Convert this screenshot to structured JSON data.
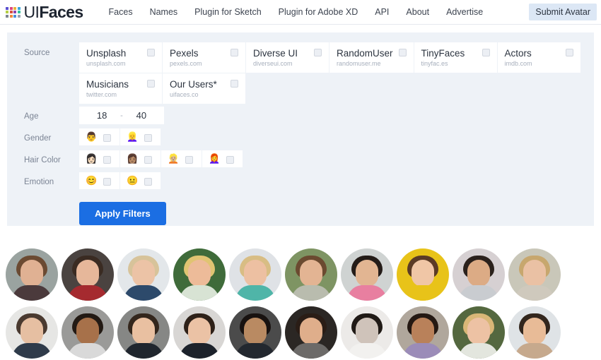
{
  "header": {
    "brand_thin": "UI",
    "brand_bold": "Faces",
    "logo_name": "uifaces-logo-grid",
    "logo_colors": [
      "#5a4fcf",
      "#e0457b",
      "#e8b23a",
      "#3aa7dc",
      "#b5cf44",
      "#d94f3d",
      "#8e44ad",
      "#36c2a0",
      "#7d8591",
      "#f08a3c",
      "#4a90d9",
      "#9aa3b0"
    ],
    "nav": [
      {
        "label": "Faces"
      },
      {
        "label": "Names"
      },
      {
        "label": "Plugin for Sketch"
      },
      {
        "label": "Plugin for Adobe XD"
      },
      {
        "label": "API"
      },
      {
        "label": "About"
      },
      {
        "label": "Advertise"
      }
    ],
    "cta_label": "Submit Avatar",
    "cta_bg": "#dce7f5"
  },
  "filters": {
    "source_label": "Source",
    "age_label": "Age",
    "gender_label": "Gender",
    "hair_label": "Hair Color",
    "emotion_label": "Emotion",
    "sources": [
      {
        "name": "Unsplash",
        "domain": "unsplash.com",
        "checked": false
      },
      {
        "name": "Pexels",
        "domain": "pexels.com",
        "checked": false
      },
      {
        "name": "Diverse UI",
        "domain": "diverseui.com",
        "checked": false
      },
      {
        "name": "RandomUser",
        "domain": "randomuser.me",
        "checked": false
      },
      {
        "name": "TinyFaces",
        "domain": "tinyfac.es",
        "checked": false
      },
      {
        "name": "Actors",
        "domain": "imdb.com",
        "checked": false
      },
      {
        "name": "Musicians",
        "domain": "twitter.com",
        "checked": false
      },
      {
        "name": "Our Users*",
        "domain": "uifaces.co",
        "checked": false
      }
    ],
    "age": {
      "min": "18",
      "max": "40",
      "separator": "-"
    },
    "genders": [
      {
        "icon": "man-emoji",
        "glyph": "👨",
        "checked": false
      },
      {
        "icon": "woman-emoji",
        "glyph": "👱‍♀️",
        "checked": false
      }
    ],
    "hair_colors": [
      {
        "icon": "black-hair-emoji",
        "glyph": "👩🏻",
        "checked": false
      },
      {
        "icon": "brown-hair-emoji",
        "glyph": "👩🏽",
        "checked": false
      },
      {
        "icon": "blonde-hair-emoji",
        "glyph": "👱🏼",
        "checked": false
      },
      {
        "icon": "red-hair-emoji",
        "glyph": "👩‍🦰",
        "checked": false
      }
    ],
    "emotions": [
      {
        "icon": "smiling-face-emoji",
        "glyph": "😊",
        "checked": false
      },
      {
        "icon": "neutral-face-emoji",
        "glyph": "😐",
        "checked": false
      }
    ],
    "apply_label": "Apply Filters",
    "apply_color": "#1b6ee3",
    "panel_bg": "#eef2f7"
  },
  "avatars": [
    {
      "alt": "bearded man outdoors",
      "bg": "#9aa3a0",
      "hair": "#6b4a32",
      "skin": "#e0b193",
      "body": "#4b3a3c"
    },
    {
      "alt": "smiling woman red sweater",
      "bg": "#4a4340",
      "hair": "#3a2b22",
      "skin": "#e6b79a",
      "body": "#a52a2f"
    },
    {
      "alt": "short blonde hair woman",
      "bg": "#e3e7ea",
      "hair": "#d7c39a",
      "skin": "#ecc3a6",
      "body": "#2d4a6b"
    },
    {
      "alt": "blonde woman green backdrop",
      "bg": "#3f6b3a",
      "hair": "#e0c472",
      "skin": "#edbb99",
      "body": "#d8e3d4"
    },
    {
      "alt": "blonde woman teal necklace",
      "bg": "#dfe2e6",
      "hair": "#d8bd84",
      "skin": "#edc0a2",
      "body": "#4fb5a8"
    },
    {
      "alt": "young man green backdrop",
      "bg": "#7e9463",
      "hair": "#6b4a30",
      "skin": "#e3b493",
      "body": "#b9bcae"
    },
    {
      "alt": "man with glasses pink shirt",
      "bg": "#cfd3d2",
      "hair": "#241c18",
      "skin": "#e2b592",
      "body": "#e87fa0"
    },
    {
      "alt": "woman yellow backdrop",
      "bg": "#e8c319",
      "hair": "#5b3b26",
      "skin": "#f0c6a6",
      "body": "#e8c319"
    },
    {
      "alt": "man grey backdrop",
      "bg": "#d6d0d2",
      "hair": "#2b211c",
      "skin": "#dcab85",
      "body": "#c9ccd0"
    },
    {
      "alt": "long haired blonde woman",
      "bg": "#c9c7b9",
      "hair": "#c7a76e",
      "skin": "#eac1a4",
      "body": "#cfc9bd"
    },
    {
      "alt": "young man light backdrop",
      "bg": "#e6e6e4",
      "hair": "#4a3a30",
      "skin": "#e6bfa2",
      "body": "#2f3b4a"
    },
    {
      "alt": "smiling man grey backdrop",
      "bg": "#9a9a98",
      "hair": "#231a14",
      "skin": "#a7714a",
      "body": "#d9d9d9"
    },
    {
      "alt": "smiling man dark jacket",
      "bg": "#868785",
      "hair": "#33261c",
      "skin": "#e9c0a1",
      "body": "#20262e"
    },
    {
      "alt": "woman dark blazer",
      "bg": "#d8d6d4",
      "hair": "#2e2119",
      "skin": "#ebc2a5",
      "body": "#1c222b"
    },
    {
      "alt": "man in suit and tie",
      "bg": "#4b4b4b",
      "hair": "#181210",
      "skin": "#b98a62",
      "body": "#23282f"
    },
    {
      "alt": "man in suit dark backdrop",
      "bg": "#2b2724",
      "hair": "#2a1d16",
      "skin": "#dfae8b",
      "body": "#6c6a68"
    },
    {
      "alt": "bearded man black and white",
      "bg": "#eceae8",
      "hair": "#201a16",
      "skin": "#cfc3ba",
      "body": "#f2f1ef"
    },
    {
      "alt": "smiling man purple shirt",
      "bg": "#b0a79c",
      "hair": "#241812",
      "skin": "#b9815a",
      "body": "#9b8cb8"
    },
    {
      "alt": "blonde woman green leaves",
      "bg": "#54683f",
      "hair": "#d9b777",
      "skin": "#edc2a4",
      "body": "#e3e6de"
    },
    {
      "alt": "woman light backdrop",
      "bg": "#dfe3e6",
      "hair": "#32261d",
      "skin": "#e8bb97",
      "body": "#c6a98d"
    }
  ]
}
